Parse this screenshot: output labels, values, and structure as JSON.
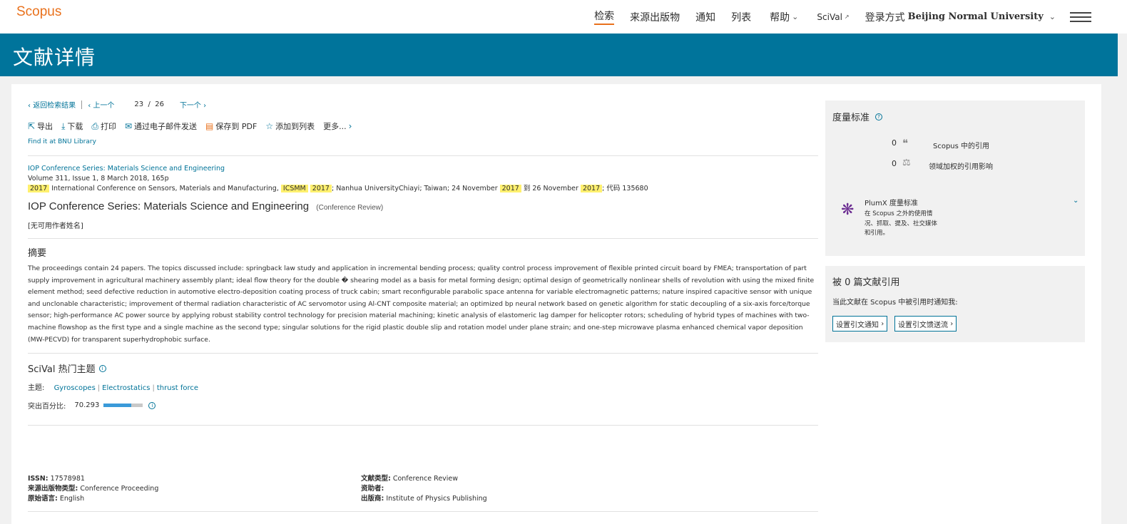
{
  "topbar": {
    "logo": "Scopus",
    "nav": [
      "检索",
      "来源出版物",
      "通知",
      "列表"
    ],
    "help": "帮助",
    "scival": "SciVal",
    "scival_icon": "external-link-icon",
    "login_prefix": "登录方式",
    "institution": "Beijing Normal University",
    "accent_color": "#e9711c"
  },
  "banner": {
    "title": "文献详情",
    "color": "#00749b"
  },
  "doc_nav": {
    "back": "返回检索结果",
    "prev": "上一个",
    "current": "23",
    "slash": "/",
    "total": "26",
    "next": "下一个"
  },
  "toolbar": {
    "export": "导出",
    "download": "下载",
    "print": "打印",
    "email": "通过电子邮件发送",
    "pdf": "保存到 PDF",
    "add_list": "添加到列表",
    "more": "更多..."
  },
  "find_library": "Find it at BNU Library",
  "source": {
    "series": "IOP Conference Series: Materials Science and Engineering",
    "volume": "Volume 311, Issue 1, 8 March 2018, 165p",
    "conf_year1": "2017",
    "conf_name": "International Conference on Sensors, Materials and Manufacturing,",
    "conf_abbr": "ICSMM",
    "conf_year2": "2017",
    "conf_place": "; Nanhua UniversityChiayi; Taiwan; 24 November",
    "conf_year3": "2017",
    "conf_to": "到 26 November",
    "conf_year4": "2017",
    "conf_code": "; 代码 135680"
  },
  "document": {
    "title": "IOP Conference Series: Materials Science and Engineering",
    "type": "(Conference Review)",
    "authors": "[无可用作者姓名]"
  },
  "abstract": {
    "heading": "摘要",
    "text": "The proceedings contain 24 papers. The topics discussed include: springback law study and application in incremental bending process; quality control process improvement of flexible printed circuit board by FMEA; transportation of part supply improvement in agricultural machinery assembly plant; ideal flow theory for the double � shearing model as a basis for metal forming design; optimal design of geometrically nonlinear shells of revolution with using the mixed finite element method; seed defective reduction in automotive electro-deposition coating process of truck cabin; smart reconfigurable parabolic space antenna for variable electromagnetic patterns; nature inspired capacitive sensor with unique and unclonable characteristic; improvement of thermal radiation characteristic of AC servomotor using Al-CNT composite material; an optimized bp neural network based on genetic algorithm for static decoupling of a six-axis force/torque sensor; high-performance AC power source by applying robust stability control technology for precision material machining; kinetic analysis of elastomeric lag damper for helicopter rotors; scheduling of hybrid types of machines with two-machine flowshop as the first type and a single machine as the second type; singular solutions for the rigid plastic double slip and rotation model under plane strain; and one-step microwave plasma enhanced chemical vapor deposition (MW-PECVD) for transparent superhydrophobic surface."
  },
  "scival": {
    "heading": "SciVal 热门主题",
    "topic_label": "主题:",
    "topics": [
      "Gyroscopes",
      "Electrostatics",
      "thrust force"
    ],
    "percentile_label": "突出百分比:",
    "percentile": "70.293",
    "percentile_fraction": 0.70293,
    "bar_color": "#3a9ad9"
  },
  "meta": {
    "issn_label": "ISSN:",
    "issn": "17578981",
    "source_type_label": "来源出版物类型:",
    "source_type": "Conference Proceeding",
    "language_label": "原始语言:",
    "language": "English",
    "doc_type_label": "文献类型:",
    "doc_type": "Conference Review",
    "sponsor_label": "资助者:",
    "publisher_label": "出版商:",
    "publisher": "Institute of Physics Publishing"
  },
  "metrics": {
    "heading": "度量标准",
    "citations_count": "0",
    "citations_label": "Scopus 中的引用",
    "fwci_count": "0",
    "fwci_label": "领域加权的引用影响",
    "plumx_title": "PlumX 度量标准",
    "plumx_desc": "在 Scopus 之外的使用情况、抓取、提及、社交媒体和引用。",
    "plumx_color": "#6b2c91"
  },
  "cited": {
    "heading": "被 0 篇文献引用",
    "notify_text": "当此文献在 Scopus 中被引用时通知我:",
    "btn_alert": "设置引文通知",
    "btn_feed": "设置引文馈送流"
  }
}
